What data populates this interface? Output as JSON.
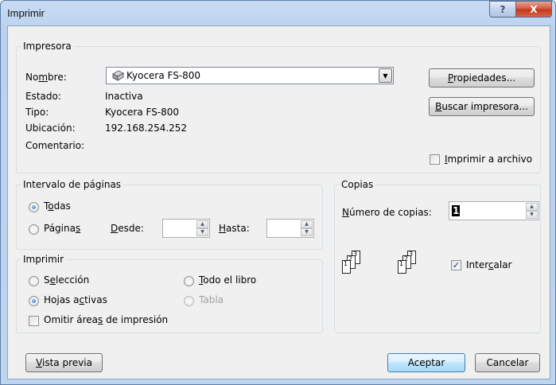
{
  "window": {
    "title": "Imprimir"
  },
  "titlebar": {
    "help_glyph": "?",
    "close_glyph": "X"
  },
  "printer": {
    "legend": "Impresora",
    "name_label_pre": "No",
    "name_label_acc": "m",
    "name_label_post": "bre:",
    "selected_printer": "Kyocera FS-800",
    "status_label": "Estado:",
    "status_value": "Inactiva",
    "type_label": "Tipo:",
    "type_value": "Kyocera FS-800",
    "location_label": "Ubicación:",
    "location_value": "192.168.254.252",
    "comment_label": "Comentario:",
    "properties_acc": "P",
    "properties_rest": "ropiedades...",
    "find_acc": "B",
    "find_rest": "uscar impresora...",
    "print_to_file_acc": "I",
    "print_to_file_rest": "mprimir a archivo"
  },
  "range": {
    "legend": "Intervalo de páginas",
    "all_pre": "T",
    "all_acc": "o",
    "all_post": "das",
    "pages_pre": "Página",
    "pages_acc": "s",
    "from_acc": "D",
    "from_rest": "esde:",
    "to_acc": "H",
    "to_rest": "asta:"
  },
  "print_what": {
    "legend": "Imprimir",
    "selection_pre": "S",
    "selection_acc": "e",
    "selection_post": "lección",
    "whole_acc": "T",
    "whole_rest": "odo el libro",
    "active_pre": "Hojas a",
    "active_acc": "c",
    "active_post": "tivas",
    "table": "Tabla",
    "ignore_pre": "Omitir área",
    "ignore_acc": "s",
    "ignore_post": " de impresión"
  },
  "copies": {
    "legend": "Copias",
    "count_acc": "N",
    "count_rest": "úmero de copias:",
    "count_value": "1",
    "collate_pre": "Inter",
    "collate_acc": "c",
    "collate_post": "alar",
    "collate_checked": true
  },
  "footer": {
    "preview_acc": "V",
    "preview_rest": "ista previa",
    "ok": "Aceptar",
    "cancel": "Cancelar"
  },
  "colors": {
    "accent": "#1a6bd3",
    "titlebar": "#c9dcf3",
    "close": "#c2391d"
  }
}
